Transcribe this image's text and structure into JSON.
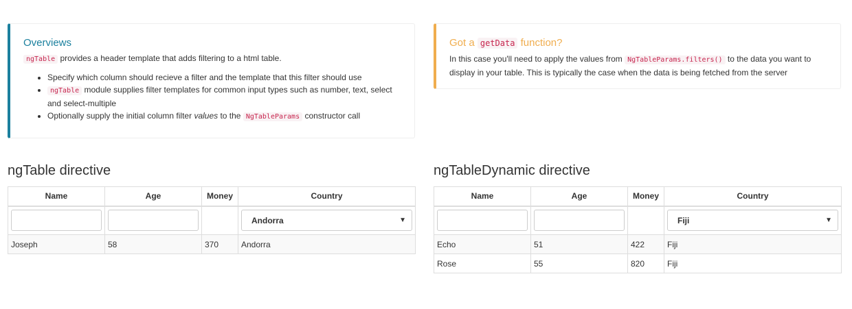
{
  "overviews": {
    "title": "Overviews",
    "intro_code": "ngTable",
    "intro_text": " provides a header template that adds filtering to a html table.",
    "bullet1": "Specify which column should recieve a filter and the template that this filter should use",
    "bullet2_code": "ngTable",
    "bullet2_text": " module supplies filter templates for common input types such as number, text, select and select-multiple",
    "bullet3_pre": "Optionally supply the initial column filter ",
    "bullet3_em": "values",
    "bullet3_mid": " to the ",
    "bullet3_code": "NgTableParams",
    "bullet3_post": " constructor call"
  },
  "getdata": {
    "title_pre": "Got a ",
    "title_code": "getData",
    "title_post": " function?",
    "text_pre": "In this case you'll need to apply the values from ",
    "text_code": "NgTableParams.filters()",
    "text_post": " to the data you want to display in your table. This is typically the case when the data is being fetched from the server"
  },
  "table1": {
    "heading": "ngTable directive",
    "headers": [
      "Name",
      "Age",
      "Money",
      "Country"
    ],
    "country_filter": "Andorra",
    "rows": [
      [
        "Joseph",
        "58",
        "370",
        "Andorra"
      ]
    ]
  },
  "table2": {
    "heading": "ngTableDynamic directive",
    "headers": [
      "Name",
      "Age",
      "Money",
      "Country"
    ],
    "country_filter": "Fiji",
    "rows": [
      [
        "Echo",
        "51",
        "422",
        "Fiji"
      ],
      [
        "Rose",
        "55",
        "820",
        "Fiji"
      ]
    ]
  },
  "colors": {
    "info": "#1b809e",
    "warning": "#f0ad4e",
    "code": "#c7254e"
  }
}
